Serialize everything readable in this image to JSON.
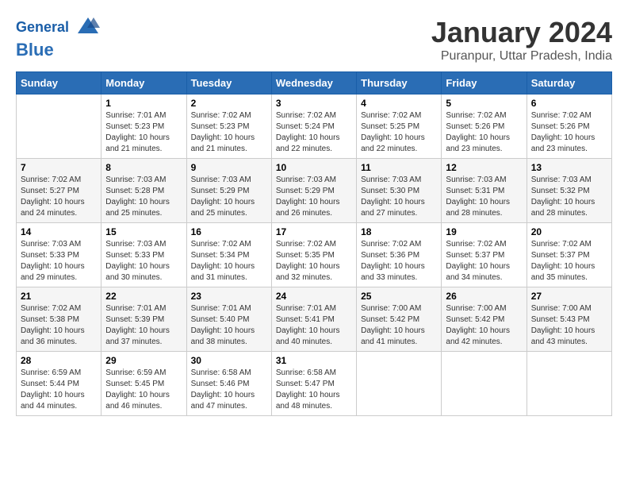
{
  "header": {
    "logo_line1": "General",
    "logo_line2": "Blue",
    "month": "January 2024",
    "location": "Puranpur, Uttar Pradesh, India"
  },
  "days_of_week": [
    "Sunday",
    "Monday",
    "Tuesday",
    "Wednesday",
    "Thursday",
    "Friday",
    "Saturday"
  ],
  "weeks": [
    [
      {
        "day": "",
        "sunrise": "",
        "sunset": "",
        "daylight": ""
      },
      {
        "day": "1",
        "sunrise": "7:01 AM",
        "sunset": "5:23 PM",
        "daylight": "10 hours and 21 minutes."
      },
      {
        "day": "2",
        "sunrise": "7:02 AM",
        "sunset": "5:23 PM",
        "daylight": "10 hours and 21 minutes."
      },
      {
        "day": "3",
        "sunrise": "7:02 AM",
        "sunset": "5:24 PM",
        "daylight": "10 hours and 22 minutes."
      },
      {
        "day": "4",
        "sunrise": "7:02 AM",
        "sunset": "5:25 PM",
        "daylight": "10 hours and 22 minutes."
      },
      {
        "day": "5",
        "sunrise": "7:02 AM",
        "sunset": "5:26 PM",
        "daylight": "10 hours and 23 minutes."
      },
      {
        "day": "6",
        "sunrise": "7:02 AM",
        "sunset": "5:26 PM",
        "daylight": "10 hours and 23 minutes."
      }
    ],
    [
      {
        "day": "7",
        "sunrise": "7:02 AM",
        "sunset": "5:27 PM",
        "daylight": "10 hours and 24 minutes."
      },
      {
        "day": "8",
        "sunrise": "7:03 AM",
        "sunset": "5:28 PM",
        "daylight": "10 hours and 25 minutes."
      },
      {
        "day": "9",
        "sunrise": "7:03 AM",
        "sunset": "5:29 PM",
        "daylight": "10 hours and 25 minutes."
      },
      {
        "day": "10",
        "sunrise": "7:03 AM",
        "sunset": "5:29 PM",
        "daylight": "10 hours and 26 minutes."
      },
      {
        "day": "11",
        "sunrise": "7:03 AM",
        "sunset": "5:30 PM",
        "daylight": "10 hours and 27 minutes."
      },
      {
        "day": "12",
        "sunrise": "7:03 AM",
        "sunset": "5:31 PM",
        "daylight": "10 hours and 28 minutes."
      },
      {
        "day": "13",
        "sunrise": "7:03 AM",
        "sunset": "5:32 PM",
        "daylight": "10 hours and 28 minutes."
      }
    ],
    [
      {
        "day": "14",
        "sunrise": "7:03 AM",
        "sunset": "5:33 PM",
        "daylight": "10 hours and 29 minutes."
      },
      {
        "day": "15",
        "sunrise": "7:03 AM",
        "sunset": "5:33 PM",
        "daylight": "10 hours and 30 minutes."
      },
      {
        "day": "16",
        "sunrise": "7:02 AM",
        "sunset": "5:34 PM",
        "daylight": "10 hours and 31 minutes."
      },
      {
        "day": "17",
        "sunrise": "7:02 AM",
        "sunset": "5:35 PM",
        "daylight": "10 hours and 32 minutes."
      },
      {
        "day": "18",
        "sunrise": "7:02 AM",
        "sunset": "5:36 PM",
        "daylight": "10 hours and 33 minutes."
      },
      {
        "day": "19",
        "sunrise": "7:02 AM",
        "sunset": "5:37 PM",
        "daylight": "10 hours and 34 minutes."
      },
      {
        "day": "20",
        "sunrise": "7:02 AM",
        "sunset": "5:37 PM",
        "daylight": "10 hours and 35 minutes."
      }
    ],
    [
      {
        "day": "21",
        "sunrise": "7:02 AM",
        "sunset": "5:38 PM",
        "daylight": "10 hours and 36 minutes."
      },
      {
        "day": "22",
        "sunrise": "7:01 AM",
        "sunset": "5:39 PM",
        "daylight": "10 hours and 37 minutes."
      },
      {
        "day": "23",
        "sunrise": "7:01 AM",
        "sunset": "5:40 PM",
        "daylight": "10 hours and 38 minutes."
      },
      {
        "day": "24",
        "sunrise": "7:01 AM",
        "sunset": "5:41 PM",
        "daylight": "10 hours and 40 minutes."
      },
      {
        "day": "25",
        "sunrise": "7:00 AM",
        "sunset": "5:42 PM",
        "daylight": "10 hours and 41 minutes."
      },
      {
        "day": "26",
        "sunrise": "7:00 AM",
        "sunset": "5:42 PM",
        "daylight": "10 hours and 42 minutes."
      },
      {
        "day": "27",
        "sunrise": "7:00 AM",
        "sunset": "5:43 PM",
        "daylight": "10 hours and 43 minutes."
      }
    ],
    [
      {
        "day": "28",
        "sunrise": "6:59 AM",
        "sunset": "5:44 PM",
        "daylight": "10 hours and 44 minutes."
      },
      {
        "day": "29",
        "sunrise": "6:59 AM",
        "sunset": "5:45 PM",
        "daylight": "10 hours and 46 minutes."
      },
      {
        "day": "30",
        "sunrise": "6:58 AM",
        "sunset": "5:46 PM",
        "daylight": "10 hours and 47 minutes."
      },
      {
        "day": "31",
        "sunrise": "6:58 AM",
        "sunset": "5:47 PM",
        "daylight": "10 hours and 48 minutes."
      },
      {
        "day": "",
        "sunrise": "",
        "sunset": "",
        "daylight": ""
      },
      {
        "day": "",
        "sunrise": "",
        "sunset": "",
        "daylight": ""
      },
      {
        "day": "",
        "sunrise": "",
        "sunset": "",
        "daylight": ""
      }
    ]
  ],
  "labels": {
    "sunrise_prefix": "Sunrise: ",
    "sunset_prefix": "Sunset: ",
    "daylight_prefix": "Daylight: "
  }
}
